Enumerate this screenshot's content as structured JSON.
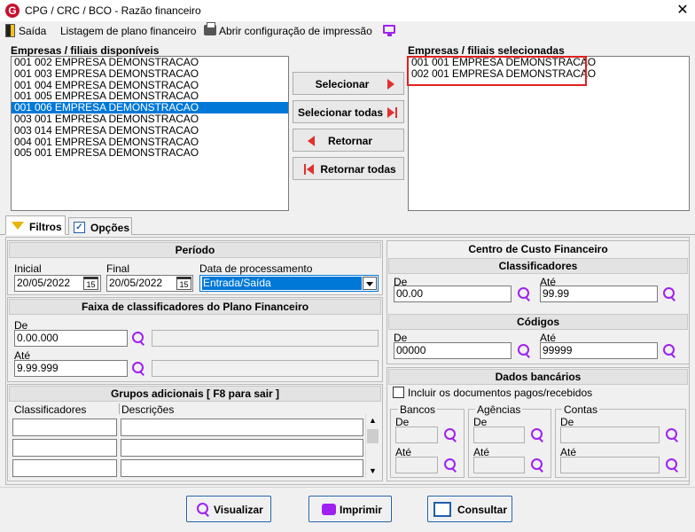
{
  "window": {
    "title": "CPG / CRC / BCO - Razão financeiro",
    "close_glyph": "✕",
    "app_icon_letter": "G"
  },
  "toolbar": {
    "exit_label": "Saída",
    "listing_label": "Listagem de plano financeiro",
    "print_config_label": "Abrir configuração de impressão"
  },
  "available": {
    "label": "Empresas / filiais disponíveis",
    "items": [
      "001 002 EMPRESA DEMONSTRACAO",
      "001 003 EMPRESA DEMONSTRACAO",
      "001 004 EMPRESA DEMONSTRACAO",
      "001 005 EMPRESA DEMONSTRACAO",
      "001 006 EMPRESA DEMONSTRACAO",
      "003 001 EMPRESA DEMONSTRACAO",
      "003 014 EMPRESA DEMONSTRACAO",
      "004 001 EMPRESA DEMONSTRACAO",
      "005 001 EMPRESA DEMONSTRACAO"
    ],
    "selected_index": 4
  },
  "selected": {
    "label": "Empresas / filiais selecionadas",
    "items": [
      "001 001 EMPRESA DEMONSTRACAO",
      "002 001 EMPRESA DEMONSTRACAO"
    ]
  },
  "buttons": {
    "select": "Selecionar",
    "select_all": "Selecionar todas",
    "back": "Retornar",
    "back_all": "Retornar todas"
  },
  "tabs": {
    "filters": "Filtros",
    "options": "Opções"
  },
  "periodo": {
    "title": "Período",
    "initial_label": "Inicial",
    "initial_value": "20/05/2022",
    "final_label": "Final",
    "final_value": "20/05/2022",
    "processing_label": "Data de processamento",
    "processing_value": "Entrada/Saída",
    "calendar_glyph": "15"
  },
  "faixa": {
    "title": "Faixa de classificadores do Plano Financeiro",
    "from_label": "De",
    "from_value": "0.00.000",
    "to_label": "Até",
    "to_value": "9.99.999"
  },
  "grupos": {
    "title": "Grupos adicionais [ F8 para sair ]",
    "col1": "Classificadores",
    "col2": "Descrições"
  },
  "centro": {
    "title": "Centro de Custo Financeiro",
    "classificadores": {
      "title": "Classificadores",
      "from_label": "De",
      "from_value": "00.00",
      "to_label": "Até",
      "to_value": "99.99"
    },
    "codigos": {
      "title": "Códigos",
      "from_label": "De",
      "from_value": "00000",
      "to_label": "Até",
      "to_value": "99999"
    }
  },
  "bancarios": {
    "title": "Dados bancários",
    "include_label": "Incluir os documentos pagos/recebidos",
    "bancos": {
      "title": "Bancos",
      "from_label": "De",
      "to_label": "Até"
    },
    "agencias": {
      "title": "Agências",
      "from_label": "De",
      "to_label": "Até"
    },
    "contas": {
      "title": "Contas",
      "from_label": "De",
      "to_label": "Até"
    }
  },
  "actions": {
    "view": "Visualizar",
    "print": "Imprimir",
    "query": "Consultar"
  },
  "colors": {
    "accent": "#0078d7",
    "highlight_box": "#e02020",
    "icon_purple": "#a020f0",
    "arrow_red": "#e03030"
  }
}
